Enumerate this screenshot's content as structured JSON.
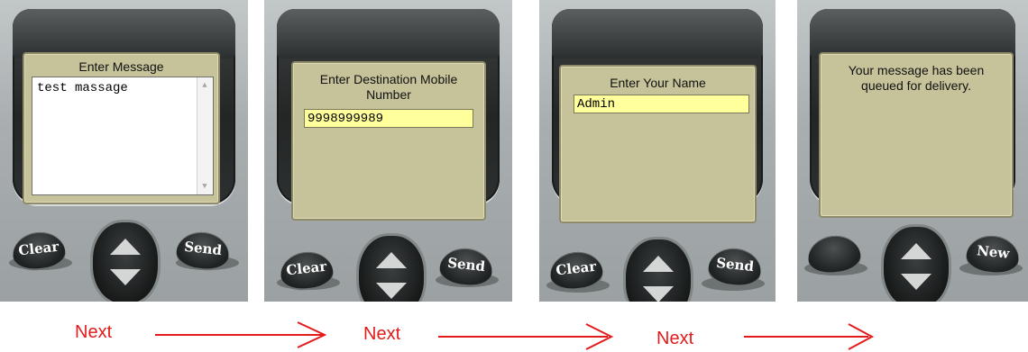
{
  "phones": [
    {
      "screen_title": "Enter Message",
      "message_value": "test massage",
      "left_softkey": "Clear",
      "right_softkey": "Send"
    },
    {
      "screen_title_line1": "Enter Destination Mobile",
      "screen_title_line2": "Number",
      "mobile_value": "9998999989",
      "left_softkey": "Clear",
      "right_softkey": "Send"
    },
    {
      "screen_title": "Enter Your Name",
      "name_value": "Admin",
      "left_softkey": "Clear",
      "right_softkey": "Send"
    },
    {
      "status_line1": "Your message has been",
      "status_line2": "queued for delivery.",
      "left_softkey": "",
      "right_softkey": "New"
    }
  ],
  "flow": {
    "next_label_1": "Next",
    "next_label_2": "Next",
    "next_label_3": "Next",
    "arrow_color": "#e31b1b"
  },
  "colors": {
    "screen_bg": "#c6c39a",
    "input_bg": "#ffff9c",
    "body_grey": "#a9afb1"
  }
}
